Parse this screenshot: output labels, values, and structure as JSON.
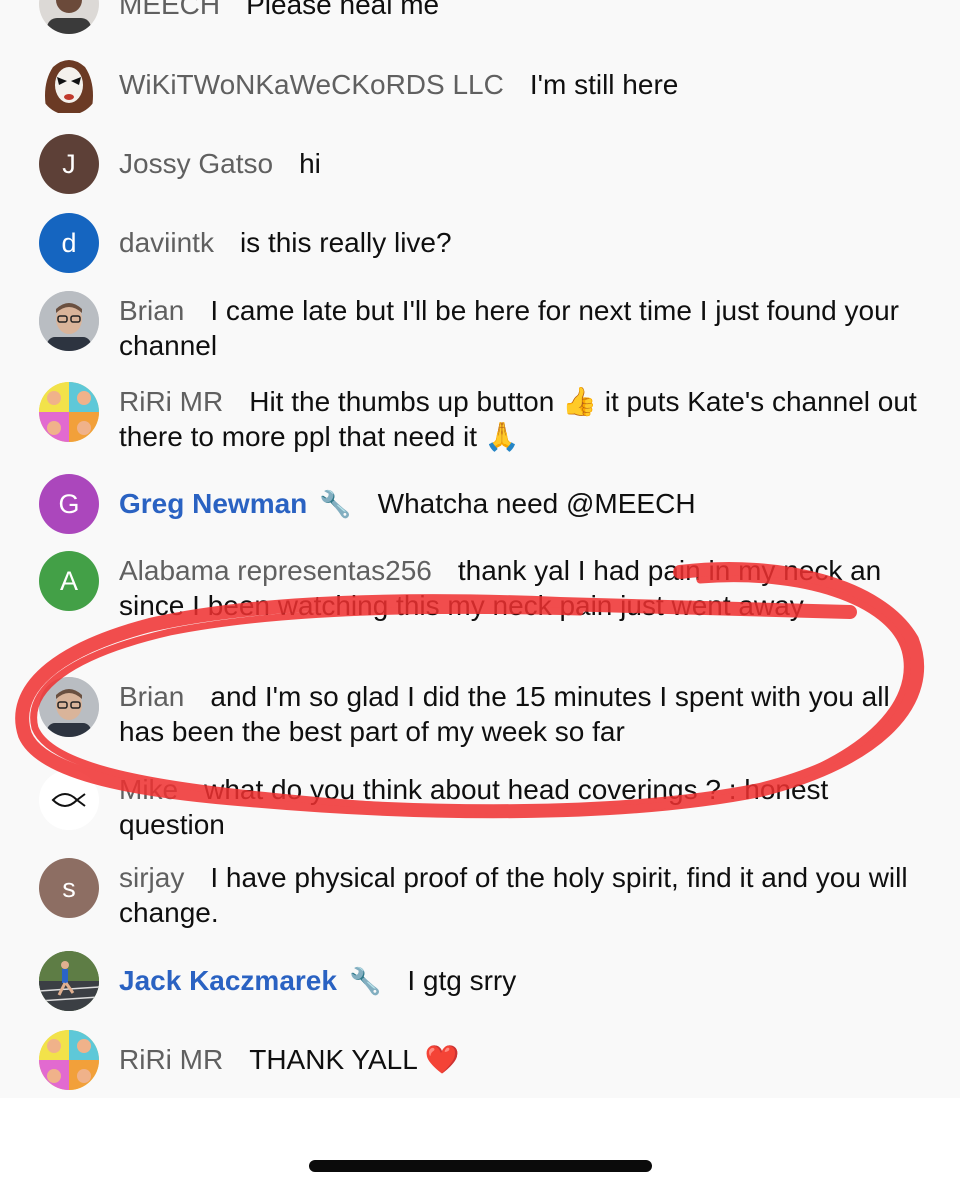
{
  "colors": {
    "background": "#f9f9f9",
    "author_gray": "#606060",
    "moderator_blue": "#2a62c2",
    "annotation_red": "#f03030"
  },
  "messages": [
    {
      "author": "MEECH",
      "text": "Please heal me",
      "avatar": {
        "kind": "photo",
        "icon": "person-photo",
        "color": "#7a6a5a"
      }
    },
    {
      "author": "WiKiTWoNKaWeCKoRDS LLC",
      "text": "I'm still here",
      "avatar": {
        "kind": "photo",
        "icon": "painted-face-photo",
        "color": "#8a3a2a"
      }
    },
    {
      "author": "Jossy Gatso",
      "text": "hi",
      "avatar": {
        "kind": "letter",
        "letter": "J",
        "color": "#5d4037"
      }
    },
    {
      "author": "daviintk",
      "text": "is this really live?",
      "avatar": {
        "kind": "letter",
        "letter": "d",
        "color": "#1565c0"
      }
    },
    {
      "author": "Brian",
      "text": "I came late but I'll be here for next time I just found your channel",
      "avatar": {
        "kind": "photo",
        "icon": "man-glasses-photo",
        "color": "#9aa0a8"
      }
    },
    {
      "author": "RiRi MR",
      "text": "Hit the thumbs up button",
      "emoji1": "👍",
      "text2": "it puts Kate's channel out there to more ppl that need it",
      "emoji2": "🙏",
      "avatar": {
        "kind": "photo",
        "icon": "pop-art-photo",
        "color": "#e9d84a"
      }
    },
    {
      "author": "Greg Newman",
      "moderator": true,
      "wrench": "🔧",
      "text": "Whatcha need @MEECH",
      "avatar": {
        "kind": "letter",
        "letter": "G",
        "color": "#ab47bc"
      }
    },
    {
      "author": "Alabama representas256",
      "text": "thank yal I had pain in my neck an since I been watching this my neck pain just went away",
      "avatar": {
        "kind": "letter",
        "letter": "A",
        "color": "#43a047"
      }
    },
    {
      "author": "Brian",
      "text": "and I'm so glad I did the 15 minutes I spent with you all has been the best part of my week so far",
      "avatar": {
        "kind": "photo",
        "icon": "man-glasses-photo",
        "color": "#9aa0a8"
      }
    },
    {
      "author": "Mike",
      "text": "what do you think about head coverings ? : honest question",
      "avatar": {
        "kind": "icon",
        "icon": "ichthys-fish-icon",
        "color": "#ffffff"
      }
    },
    {
      "author": "sirjay",
      "text": "I have physical proof of the holy spirit, find it and you will change.",
      "avatar": {
        "kind": "letter",
        "letter": "s",
        "color": "#8d6e63"
      }
    },
    {
      "author": "Jack Kaczmarek",
      "moderator": true,
      "wrench": "🔧",
      "text": "I gtg srry",
      "avatar": {
        "kind": "photo",
        "icon": "runner-track-photo",
        "color": "#4e6b3a"
      }
    },
    {
      "author": "RiRi MR",
      "text": "THANK YALL",
      "emoji1": "❤️",
      "avatar": {
        "kind": "photo",
        "icon": "pop-art-photo",
        "color": "#e9d84a"
      }
    }
  ]
}
